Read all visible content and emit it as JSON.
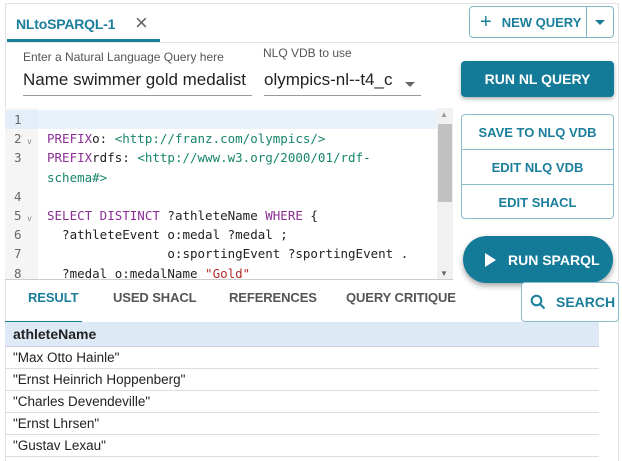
{
  "tab": {
    "label": "NLtoSPARQL-1",
    "close_icon": "close-icon"
  },
  "new_query": {
    "label": "NEW QUERY",
    "icon": "plus-icon"
  },
  "nl_query": {
    "label": "Enter a Natural Language Query here",
    "value": "Name swimmer gold medalist"
  },
  "vdb": {
    "label": "NLQ VDB to use",
    "value": "olympics-nl--t4_c"
  },
  "buttons": {
    "run_nl": "RUN NL QUERY",
    "save": "SAVE TO NLQ VDB",
    "edit_vdb": "EDIT NLQ VDB",
    "edit_shacl": "EDIT SHACL",
    "run_sparql": "RUN SPARQL",
    "search": "SEARCH"
  },
  "editor": {
    "lines": [
      {
        "n": "1",
        "parts": []
      },
      {
        "n": "2",
        "fold": true,
        "parts": [
          [
            "kw",
            "PREFIX"
          ],
          [
            "",
            "o: "
          ],
          [
            "url",
            "<http://franz.com/olympics/>"
          ]
        ]
      },
      {
        "n": "3",
        "parts": [
          [
            "kw",
            "PREFIX"
          ],
          [
            "",
            "rdfs: "
          ],
          [
            "url",
            "<http://www.w3.org/2000/01/rdf-"
          ]
        ]
      },
      {
        "n": "",
        "parts": [
          [
            "url",
            "schema#>"
          ]
        ]
      },
      {
        "n": "4",
        "parts": []
      },
      {
        "n": "5",
        "fold": true,
        "parts": [
          [
            "kw",
            "SELECT DISTINCT"
          ],
          [
            "",
            " ?athleteName "
          ],
          [
            "kw",
            "WHERE"
          ],
          [
            "",
            " {"
          ]
        ]
      },
      {
        "n": "6",
        "parts": [
          [
            "",
            "  ?athleteEvent o:medal ?medal ;"
          ]
        ]
      },
      {
        "n": "7",
        "parts": [
          [
            "",
            "                o:sportingEvent ?sportingEvent ."
          ]
        ]
      },
      {
        "n": "8",
        "parts": [
          [
            "",
            "  ?medal o:medalName "
          ],
          [
            "str",
            "\"Gold\""
          ]
        ]
      }
    ]
  },
  "result_tabs": [
    "RESULT",
    "USED SHACL",
    "REFERENCES",
    "QUERY CRITIQUE"
  ],
  "colors": {
    "accent": "#137b98"
  },
  "table": {
    "header": "athleteName",
    "rows": [
      "\"Max Otto Hainle\"",
      "\"Ernst Heinrich Hoppenberg\"",
      "\"Charles Devendeville\"",
      "\"Ernst Lhrsen\"",
      "\"Gustav Lexau\""
    ]
  }
}
